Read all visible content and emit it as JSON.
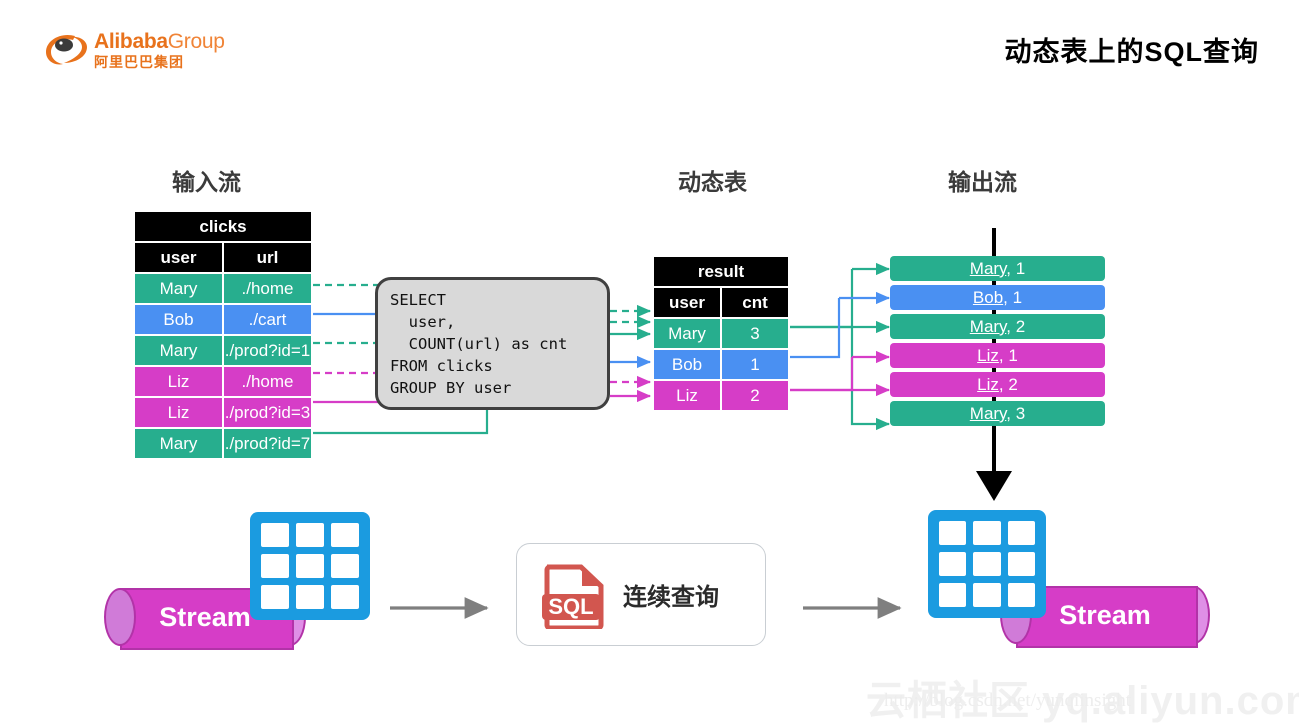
{
  "brand": {
    "name_en": "Alibaba",
    "name_en_suffix": "Group",
    "name_cn": "阿里巴巴集团",
    "logo_icon": "alibaba-logo-icon",
    "color": "#E8721C"
  },
  "header": {
    "title": "动态表上的SQL查询"
  },
  "sections": {
    "input_stream": "输入流",
    "dynamic_table": "动态表",
    "output_stream": "输出流"
  },
  "colors": {
    "green": "#27AE8E",
    "blue": "#4A90F2",
    "magenta": "#D63DC7",
    "black": "#000000",
    "grey_arrow": "#7F7F7F",
    "sql_box_fill": "#D9D9D9",
    "sql_box_border": "#404040"
  },
  "clicks_table": {
    "title": "clicks",
    "columns": [
      "user",
      "url"
    ],
    "rows": [
      {
        "user": "Mary",
        "url": "./home",
        "color": "green"
      },
      {
        "user": "Bob",
        "url": "./cart",
        "color": "blue"
      },
      {
        "user": "Mary",
        "url": "./prod?id=1",
        "color": "green"
      },
      {
        "user": "Liz",
        "url": "./home",
        "color": "magenta"
      },
      {
        "user": "Liz",
        "url": "./prod?id=3",
        "color": "magenta"
      },
      {
        "user": "Mary",
        "url": "./prod?id=7",
        "color": "green"
      }
    ]
  },
  "sql_query": {
    "text": "SELECT\n  user,\n  COUNT(url) as cnt\nFROM clicks\nGROUP BY user"
  },
  "result_table": {
    "title": "result",
    "columns": [
      "user",
      "cnt"
    ],
    "rows": [
      {
        "user": "Mary",
        "cnt": "3",
        "color": "green"
      },
      {
        "user": "Bob",
        "cnt": "1",
        "color": "blue"
      },
      {
        "user": "Liz",
        "cnt": "2",
        "color": "magenta"
      }
    ]
  },
  "output_stream": {
    "rows": [
      {
        "name": "Mary",
        "value": "1",
        "color": "green"
      },
      {
        "name": "Bob",
        "value": "1",
        "color": "blue"
      },
      {
        "name": "Mary",
        "value": "2",
        "color": "green"
      },
      {
        "name": "Liz",
        "value": "1",
        "color": "magenta"
      },
      {
        "name": "Liz",
        "value": "2",
        "color": "magenta"
      },
      {
        "name": "Mary",
        "value": "3",
        "color": "green"
      }
    ]
  },
  "bottom": {
    "stream_left_label": "Stream",
    "stream_right_label": "Stream",
    "query_label": "连续查询",
    "sql_file_badge": "SQL",
    "table_icon_left": "table-grid-icon",
    "table_icon_right": "table-grid-icon",
    "arrow_left_icon": "arrow-right-icon",
    "arrow_right_icon": "arrow-right-icon"
  },
  "watermark": {
    "line1": "云栖社区 yq.aliyun.com",
    "line2": "http://blog.csdn.net/yunqiinsight"
  }
}
